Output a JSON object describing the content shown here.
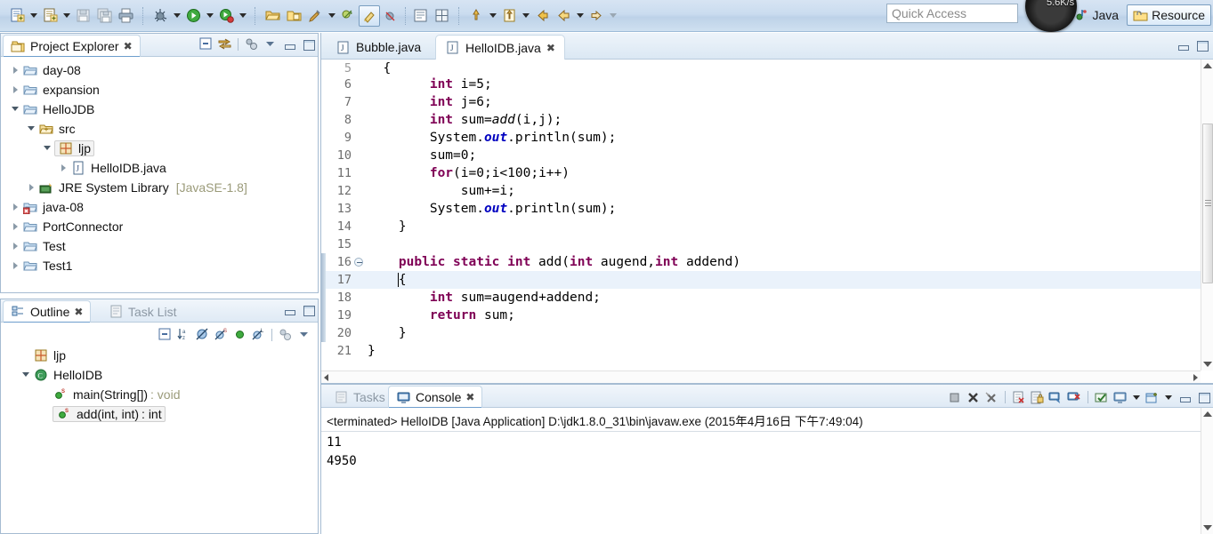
{
  "toolbar": {
    "groups": [
      {
        "name": "file-group",
        "buttons": [
          {
            "icon": "new-wizard-icon",
            "label": "New"
          },
          {
            "icon": "dropdown-arrow-icon",
            "label": "New menu"
          },
          {
            "icon": "new-java-class-icon",
            "label": "New Java Class"
          },
          {
            "icon": "dropdown-arrow-icon",
            "label": "New Java Class menu"
          },
          {
            "icon": "save-icon",
            "label": "Save"
          },
          {
            "icon": "save-all-icon",
            "label": "Save All"
          },
          {
            "icon": "print-icon",
            "label": "Print"
          }
        ]
      },
      {
        "name": "run-group",
        "buttons": [
          {
            "icon": "debug-icon",
            "label": "Debug"
          },
          {
            "icon": "dropdown-arrow-icon",
            "label": "Debug menu"
          },
          {
            "icon": "run-icon",
            "label": "Run"
          },
          {
            "icon": "dropdown-arrow-icon",
            "label": "Run menu"
          },
          {
            "icon": "run-external-tools-icon",
            "label": "External Tools"
          },
          {
            "icon": "dropdown-arrow-icon",
            "label": "External Tools menu"
          }
        ]
      },
      {
        "name": "project-group",
        "buttons": [
          {
            "icon": "open-type-icon",
            "label": "Open Type"
          },
          {
            "icon": "open-task-icon",
            "label": "Open Task"
          },
          {
            "icon": "search-icon",
            "label": "Search"
          },
          {
            "icon": "dropdown-arrow-icon",
            "label": "Search menu"
          },
          {
            "icon": "next-annotation-icon",
            "label": "Next Annotation"
          },
          {
            "icon": "toggle-mark-occurrences-icon",
            "label": "Toggle Mark Occurrences"
          },
          {
            "icon": "skip-all-breakpoints-icon",
            "label": "Skip All Breakpoints"
          },
          {
            "icon": "new-java-project-icon",
            "label": "New Java Project"
          },
          {
            "icon": "new-package-icon",
            "label": "New Package"
          }
        ]
      },
      {
        "name": "nav-group",
        "buttons": [
          {
            "icon": "last-edit-location-icon",
            "label": "Last Edit Location"
          },
          {
            "icon": "dropdown-arrow-icon",
            "label": "Last Edit menu"
          },
          {
            "icon": "forward-to-editor-icon",
            "label": "Next Editor"
          },
          {
            "icon": "dropdown-arrow-icon",
            "label": "Next Editor menu"
          },
          {
            "icon": "back-icon",
            "label": "Back"
          },
          {
            "icon": "back-history-icon",
            "label": "Back History"
          },
          {
            "icon": "dropdown-arrow-icon",
            "label": "Back History menu"
          },
          {
            "icon": "forward-icon",
            "label": "Forward"
          },
          {
            "icon": "dropdown-arrow-icon",
            "label": "Forward menu"
          }
        ]
      }
    ],
    "quick_access_placeholder": "Quick Access",
    "speed_indicator": "5.6K/s",
    "perspectives": [
      {
        "label": "Java",
        "icon": "java-perspective-icon",
        "active": false
      },
      {
        "label": "Resource",
        "icon": "resource-perspective-icon",
        "active": true
      }
    ],
    "open_perspective_label": "Open Perspective"
  },
  "project_explorer": {
    "title": "Project Explorer",
    "tab_close": "✖",
    "tools": [
      {
        "icon": "collapse-all-icon",
        "label": "Collapse All"
      },
      {
        "icon": "link-with-editor-icon",
        "label": "Link with Editor"
      },
      {
        "icon": "focus-on-active-task-icon",
        "label": "Focus on Active Task"
      },
      {
        "icon": "view-menu-icon",
        "label": "View Menu"
      },
      {
        "icon": "minimize-icon",
        "label": "Minimize"
      },
      {
        "icon": "maximize-icon",
        "label": "Maximize"
      }
    ],
    "tree": [
      {
        "label": "day-08",
        "sub": "",
        "indent": 0,
        "state": "collapsed",
        "icon": "project-folder-icon",
        "selected": false
      },
      {
        "label": "expansion",
        "sub": "",
        "indent": 0,
        "state": "collapsed",
        "icon": "project-folder-icon",
        "selected": false
      },
      {
        "label": "HelloJDB",
        "sub": "",
        "indent": 0,
        "state": "expanded",
        "icon": "project-folder-icon",
        "selected": false
      },
      {
        "label": "src",
        "sub": "",
        "indent": 1,
        "state": "expanded",
        "icon": "source-folder-icon",
        "selected": false
      },
      {
        "label": "ljp",
        "sub": "",
        "indent": 2,
        "state": "expanded",
        "icon": "package-icon",
        "selected": true
      },
      {
        "label": "HelloIDB.java",
        "sub": "",
        "indent": 3,
        "state": "collapsed",
        "icon": "java-file-icon",
        "selected": false
      },
      {
        "label": "JRE System Library",
        "sub": "[JavaSE-1.8]",
        "indent": 1,
        "state": "collapsed",
        "icon": "jre-library-icon",
        "selected": false
      },
      {
        "label": "java-08",
        "sub": "",
        "indent": 0,
        "state": "collapsed",
        "icon": "java-project-error-icon",
        "selected": false
      },
      {
        "label": "PortConnector",
        "sub": "",
        "indent": 0,
        "state": "collapsed",
        "icon": "project-folder-icon",
        "selected": false
      },
      {
        "label": "Test",
        "sub": "",
        "indent": 0,
        "state": "collapsed",
        "icon": "project-folder-icon",
        "selected": false
      },
      {
        "label": "Test1",
        "sub": "",
        "indent": 0,
        "state": "collapsed",
        "icon": "project-folder-icon",
        "selected": false
      }
    ]
  },
  "outline": {
    "tabs": [
      {
        "label": "Outline",
        "icon": "outline-icon",
        "active": true,
        "close": "✖"
      },
      {
        "label": "Task List",
        "icon": "task-list-icon",
        "active": false,
        "close": ""
      }
    ],
    "window_tools": [
      {
        "icon": "minimize-icon",
        "label": "Minimize"
      },
      {
        "icon": "maximize-icon",
        "label": "Maximize"
      }
    ],
    "tools": [
      {
        "icon": "collapse-all-icon",
        "label": "Collapse All"
      },
      {
        "icon": "sort-icon",
        "label": "Sort"
      },
      {
        "icon": "hide-fields-icon",
        "label": "Hide Fields"
      },
      {
        "icon": "hide-static-icon",
        "label": "Hide Static Fields and Methods"
      },
      {
        "icon": "hide-non-public-icon",
        "label": "Hide Non-Public Members"
      },
      {
        "icon": "hide-local-types-icon",
        "label": "Hide Local Types"
      },
      {
        "icon": "focus-on-active-task-icon",
        "label": "Focus on Active Task"
      },
      {
        "icon": "view-menu-icon",
        "label": "View Menu"
      }
    ],
    "tree": [
      {
        "label": "ljp",
        "indent": 0,
        "state": "none",
        "icon": "package-icon",
        "selected": false,
        "type": ""
      },
      {
        "label": "HelloIDB",
        "indent": 0,
        "state": "expanded",
        "icon": "java-class-icon",
        "selected": false,
        "type": ""
      },
      {
        "label": "main(String[])",
        "indent": 1,
        "state": "none",
        "icon": "public-static-method-icon",
        "selected": false,
        "type": "void"
      },
      {
        "label": "add(int, int)",
        "indent": 1,
        "state": "none",
        "icon": "public-static-method-icon",
        "selected": true,
        "type": "int"
      }
    ]
  },
  "editor": {
    "tabs": [
      {
        "label": "Bubble.java",
        "icon": "java-file-icon",
        "active": false,
        "close": ""
      },
      {
        "label": "HelloIDB.java",
        "icon": "java-file-icon",
        "active": true,
        "close": "✖"
      }
    ],
    "window_tools": [
      {
        "icon": "minimize-icon",
        "label": "Minimize"
      },
      {
        "icon": "maximize-icon",
        "label": "Maximize"
      }
    ],
    "lines": [
      {
        "num": "5",
        "fold": false,
        "changed": false,
        "current": false,
        "partial": true,
        "tokens": [
          {
            "t": "  {",
            "c": "pl"
          }
        ]
      },
      {
        "num": "6",
        "fold": false,
        "changed": false,
        "current": false,
        "tokens": [
          {
            "t": "        ",
            "c": "pl"
          },
          {
            "t": "int",
            "c": "kw"
          },
          {
            "t": " i=5;",
            "c": "pl"
          }
        ]
      },
      {
        "num": "7",
        "fold": false,
        "changed": false,
        "current": false,
        "tokens": [
          {
            "t": "        ",
            "c": "pl"
          },
          {
            "t": "int",
            "c": "kw"
          },
          {
            "t": " j=6;",
            "c": "pl"
          }
        ]
      },
      {
        "num": "8",
        "fold": false,
        "changed": false,
        "current": false,
        "tokens": [
          {
            "t": "        ",
            "c": "pl"
          },
          {
            "t": "int",
            "c": "kw"
          },
          {
            "t": " sum=",
            "c": "pl"
          },
          {
            "t": "add",
            "c": "mth"
          },
          {
            "t": "(i,j);",
            "c": "pl"
          }
        ]
      },
      {
        "num": "9",
        "fold": false,
        "changed": false,
        "current": false,
        "tokens": [
          {
            "t": "        System.",
            "c": "pl"
          },
          {
            "t": "out",
            "c": "fld"
          },
          {
            "t": ".println(sum);",
            "c": "pl"
          }
        ]
      },
      {
        "num": "10",
        "fold": false,
        "changed": false,
        "current": false,
        "tokens": [
          {
            "t": "        sum=0;",
            "c": "pl"
          }
        ]
      },
      {
        "num": "11",
        "fold": false,
        "changed": false,
        "current": false,
        "tokens": [
          {
            "t": "        ",
            "c": "pl"
          },
          {
            "t": "for",
            "c": "kw"
          },
          {
            "t": "(i=0;i<100;i++)",
            "c": "pl"
          }
        ]
      },
      {
        "num": "12",
        "fold": false,
        "changed": false,
        "current": false,
        "tokens": [
          {
            "t": "            sum+=i;",
            "c": "pl"
          }
        ]
      },
      {
        "num": "13",
        "fold": false,
        "changed": false,
        "current": false,
        "tokens": [
          {
            "t": "        System.",
            "c": "pl"
          },
          {
            "t": "out",
            "c": "fld"
          },
          {
            "t": ".println(sum);",
            "c": "pl"
          }
        ]
      },
      {
        "num": "14",
        "fold": false,
        "changed": false,
        "current": false,
        "tokens": [
          {
            "t": "    }",
            "c": "pl"
          }
        ]
      },
      {
        "num": "15",
        "fold": false,
        "changed": false,
        "current": false,
        "tokens": [
          {
            "t": "",
            "c": "pl"
          }
        ]
      },
      {
        "num": "16",
        "fold": true,
        "changed": true,
        "current": false,
        "tokens": [
          {
            "t": "    ",
            "c": "pl"
          },
          {
            "t": "public static int",
            "c": "kw"
          },
          {
            "t": " add(",
            "c": "pl"
          },
          {
            "t": "int",
            "c": "kw"
          },
          {
            "t": " augend,",
            "c": "pl"
          },
          {
            "t": "int",
            "c": "kw"
          },
          {
            "t": " addend)",
            "c": "pl"
          }
        ]
      },
      {
        "num": "17",
        "fold": false,
        "changed": true,
        "current": true,
        "cursor": true,
        "tokens": [
          {
            "t": "    {",
            "c": "pl"
          }
        ]
      },
      {
        "num": "18",
        "fold": false,
        "changed": true,
        "current": false,
        "tokens": [
          {
            "t": "        ",
            "c": "pl"
          },
          {
            "t": "int",
            "c": "kw"
          },
          {
            "t": " sum=augend+addend;",
            "c": "pl"
          }
        ]
      },
      {
        "num": "19",
        "fold": false,
        "changed": true,
        "current": false,
        "tokens": [
          {
            "t": "        ",
            "c": "pl"
          },
          {
            "t": "return",
            "c": "kw"
          },
          {
            "t": " sum;",
            "c": "pl"
          }
        ]
      },
      {
        "num": "20",
        "fold": false,
        "changed": true,
        "current": false,
        "tokens": [
          {
            "t": "    }",
            "c": "pl"
          }
        ]
      },
      {
        "num": "21",
        "fold": false,
        "changed": false,
        "current": false,
        "tokens": [
          {
            "t": "}",
            "c": "pl"
          }
        ]
      }
    ]
  },
  "console": {
    "tabs": [
      {
        "label": "Tasks",
        "icon": "tasks-icon",
        "active": false,
        "close": ""
      },
      {
        "label": "Console",
        "icon": "console-icon",
        "active": true,
        "close": "✖"
      }
    ],
    "tools": [
      {
        "icon": "terminate-icon",
        "label": "Terminate",
        "pressed": false
      },
      {
        "icon": "remove-launch-icon",
        "label": "Remove Launch",
        "pressed": false
      },
      {
        "icon": "remove-all-terminated-icon",
        "label": "Remove All Terminated",
        "pressed": false
      },
      {
        "icon": "clear-console-icon",
        "label": "Clear Console",
        "pressed": false
      },
      {
        "icon": "scroll-lock-icon",
        "label": "Scroll Lock",
        "pressed": false
      },
      {
        "icon": "pin-console-icon",
        "label": "Pin Console",
        "pressed": true
      },
      {
        "icon": "display-selected-console-icon",
        "label": "Display Selected Console",
        "pressed": true
      },
      {
        "icon": "open-console-icon",
        "label": "Open Console",
        "pressed": false
      },
      {
        "icon": "show-console-icon",
        "label": "Show Console When Output Changes",
        "pressed": false
      },
      {
        "icon": "dropdown-arrow-icon",
        "label": "Show Console menu",
        "pressed": false
      },
      {
        "icon": "new-console-view-icon",
        "label": "New Console View",
        "pressed": false
      },
      {
        "icon": "dropdown-arrow-icon",
        "label": "New Console View menu",
        "pressed": false
      },
      {
        "icon": "minimize-icon",
        "label": "Minimize",
        "pressed": false
      },
      {
        "icon": "maximize-icon",
        "label": "Maximize",
        "pressed": false
      }
    ],
    "header": "<terminated> HelloIDB [Java Application] D:\\jdk1.8.0_31\\bin\\javaw.exe (2015年4月16日 下午7:49:04)",
    "output": [
      "11",
      "4950"
    ]
  },
  "colors": {
    "keyword": "#7f0055",
    "field": "#0000c0",
    "chrome": "#cadcef",
    "current_line": "#eaf2fb",
    "selection_tab": "#6e9ecd"
  }
}
